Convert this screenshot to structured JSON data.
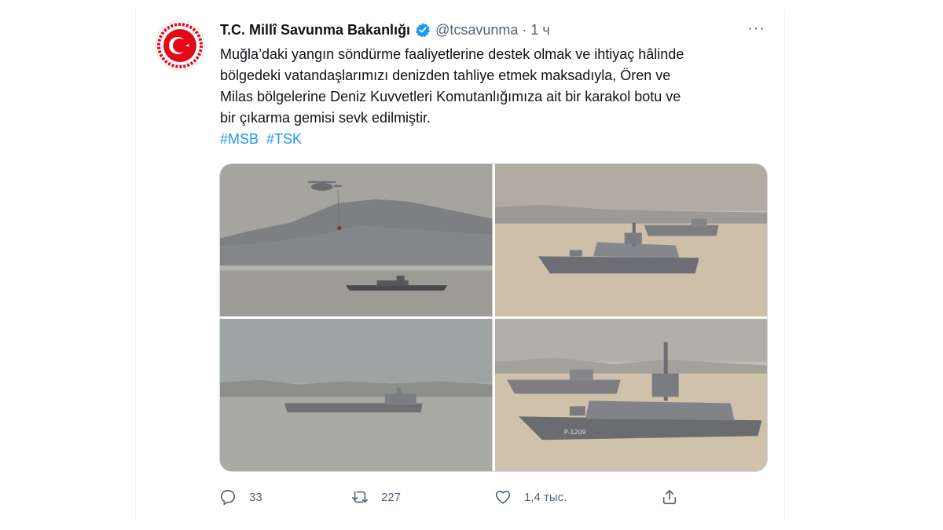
{
  "tweet": {
    "display_name": "T.C. Millî Savunma Bakanlığı",
    "handle": "@tcsavunma",
    "separator": "·",
    "time": "1 ч",
    "more": "···",
    "text_lines": [
      "Muğla’daki yangın söndürme faaliyetlerine destek olmak ve ihtiyaç hâlinde",
      "bölgedeki vatandaşlarımızı denizden tahliye etmek maksadıyla, Ören ve",
      "Milas bölgelerine Deniz Kuvvetleri Komutanlığımıza ait bir karakol botu ve",
      "bir çıkarma gemisi sevk edilmiştir."
    ],
    "hashtags": [
      "#MSB",
      "#TSK"
    ],
    "photo_label": "P-1209"
  },
  "actions": {
    "reply_count": "33",
    "retweet_count": "227",
    "like_count": "1,4 тыс.",
    "share": ""
  },
  "colors": {
    "accent": "#1d9bf0",
    "muted": "#536471",
    "text": "#0f1419",
    "logo_red": "#e30a17"
  },
  "icons": [
    "verified-badge-icon",
    "more-icon",
    "reply-icon",
    "retweet-icon",
    "like-icon",
    "share-icon"
  ]
}
